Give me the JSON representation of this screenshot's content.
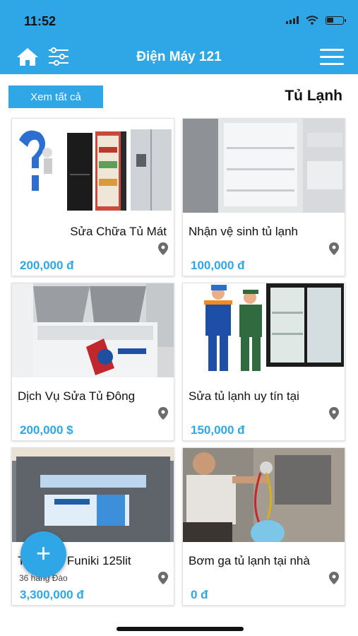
{
  "status": {
    "time": "11:52"
  },
  "header": {
    "title": "Điện Máy 121"
  },
  "section": {
    "view_all_label": "Xem tất cả",
    "title": "Tủ Lạnh"
  },
  "products": [
    {
      "name": "Sửa Chữa Tủ Mát",
      "location": "",
      "price": "200,000 đ",
      "name_align": "right"
    },
    {
      "name": "Nhận vệ sinh tủ lạnh",
      "location": "",
      "price": "100,000 đ",
      "name_align": "left"
    },
    {
      "name": "Dịch Vụ Sửa Tủ Đông",
      "location": "",
      "price": "200,000 $",
      "name_align": "left"
    },
    {
      "name": "Sửa tủ lạnh uy tín tại",
      "location": "",
      "price": "150,000 đ",
      "name_align": "left"
    },
    {
      "name": "Tủ Đông Funiki 125lit",
      "location": "36 hàng Đào",
      "price": "3,300,000 đ",
      "name_align": "left"
    },
    {
      "name": "Bơm ga tủ lạnh tại nhà",
      "location": "",
      "price": "0 đ",
      "name_align": "left"
    }
  ],
  "fab": {
    "label": "+"
  },
  "colors": {
    "accent": "#2fa6e6"
  },
  "icons": [
    "home-icon",
    "filter-icon",
    "menu-icon",
    "location-pin-icon",
    "plus-icon"
  ]
}
